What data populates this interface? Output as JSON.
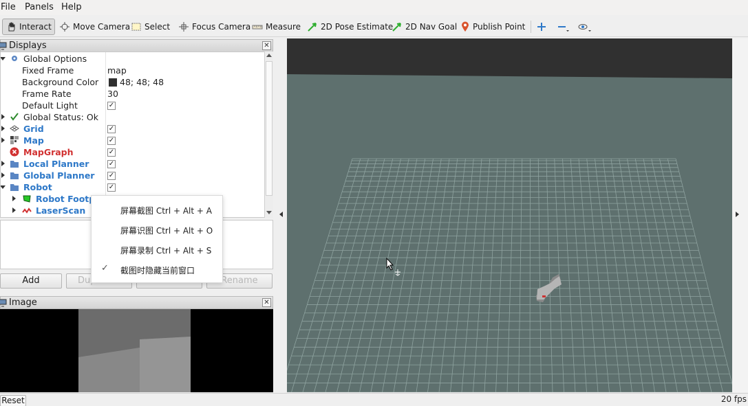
{
  "menu": {
    "file": "File",
    "panels": "Panels",
    "help": "Help"
  },
  "toolbar": {
    "interact": "Interact",
    "move_camera": "Move Camera",
    "select": "Select",
    "focus_camera": "Focus Camera",
    "measure": "Measure",
    "pose_estimate": "2D Pose Estimate",
    "nav_goal": "2D Nav Goal",
    "publish_point": "Publish Point"
  },
  "displays": {
    "title": "Displays",
    "rows": [
      {
        "label": "Global Options"
      },
      {
        "label": "Fixed Frame",
        "value": "map"
      },
      {
        "label": "Background Color",
        "value": "48; 48; 48"
      },
      {
        "label": "Frame Rate",
        "value": "30"
      },
      {
        "label": "Default Light",
        "check": "✓"
      },
      {
        "label": "Global Status: Ok"
      },
      {
        "label": "Grid",
        "check": "✓"
      },
      {
        "label": "Map",
        "check": "✓"
      },
      {
        "label": "MapGraph",
        "check": "✓"
      },
      {
        "label": "Local Planner",
        "check": "✓"
      },
      {
        "label": "Global Planner",
        "check": "✓"
      },
      {
        "label": "Robot",
        "check": "✓"
      },
      {
        "label": "Robot Footp..."
      },
      {
        "label": "LaserScan"
      }
    ],
    "buttons": {
      "add": "Add",
      "duplicate": "Duplicate",
      "remove": "Remove",
      "rename": "Rename"
    }
  },
  "context_menu": {
    "items": [
      "屏幕截图 Ctrl + Alt + A",
      "屏幕识图 Ctrl + Alt + O",
      "屏幕录制 Ctrl + Alt + S",
      "截图时隐藏当前窗口"
    ]
  },
  "image_panel": {
    "title": "Image"
  },
  "status": {
    "reset": "Reset",
    "fps": "20 fps"
  },
  "colors": {
    "viewport": "#5e706e",
    "top_band": "#303030",
    "accent_blue": "#2d78c8",
    "error_red": "#d13131"
  }
}
